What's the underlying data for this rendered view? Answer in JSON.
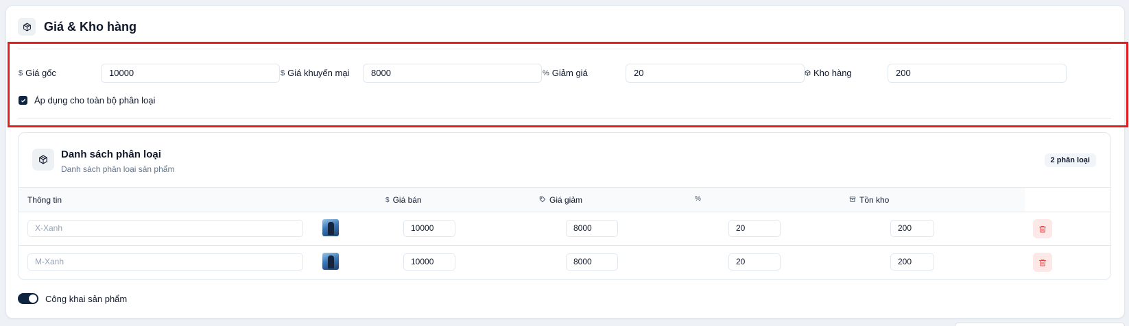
{
  "section": {
    "title": "Giá & Kho hàng",
    "icon": "package-icon"
  },
  "pricing": {
    "fields": [
      {
        "symbol": "$",
        "label": "Giá gốc",
        "value": "10000",
        "icon": "dollar-icon"
      },
      {
        "symbol": "$",
        "label": "Giá khuyến mại",
        "value": "8000",
        "icon": "dollar-icon"
      },
      {
        "symbol": "%",
        "label": "Giảm giá",
        "value": "20",
        "icon": "percent-icon"
      },
      {
        "symbol": "⊕",
        "label": "Kho hàng",
        "value": "200",
        "icon": "package-icon"
      }
    ],
    "apply_all_label": "Áp dụng cho toàn bộ phân loại",
    "apply_all_checked": true
  },
  "variants": {
    "title": "Danh sách phân loại",
    "subtitle": "Danh sách phân loại sản phẩm",
    "badge": "2 phân loại",
    "columns": {
      "info": "Thông tin",
      "price_symbol": "$",
      "price": "Giá bán",
      "discount_price": "Giá giảm",
      "percent": "%",
      "stock": "Tồn kho"
    },
    "rows": [
      {
        "name_placeholder": "X-Xanh",
        "price": "10000",
        "discount_price": "8000",
        "percent": "20",
        "stock": "200"
      },
      {
        "name_placeholder": "M-Xanh",
        "price": "10000",
        "discount_price": "8000",
        "percent": "20",
        "stock": "200"
      }
    ]
  },
  "public_toggle": {
    "label": "Công khai sản phẩm",
    "on": true
  },
  "colors": {
    "highlight": "#e11d1d",
    "primary_dark": "#0f2440",
    "danger": "#ef4444",
    "danger_bg": "#fde8e8"
  }
}
